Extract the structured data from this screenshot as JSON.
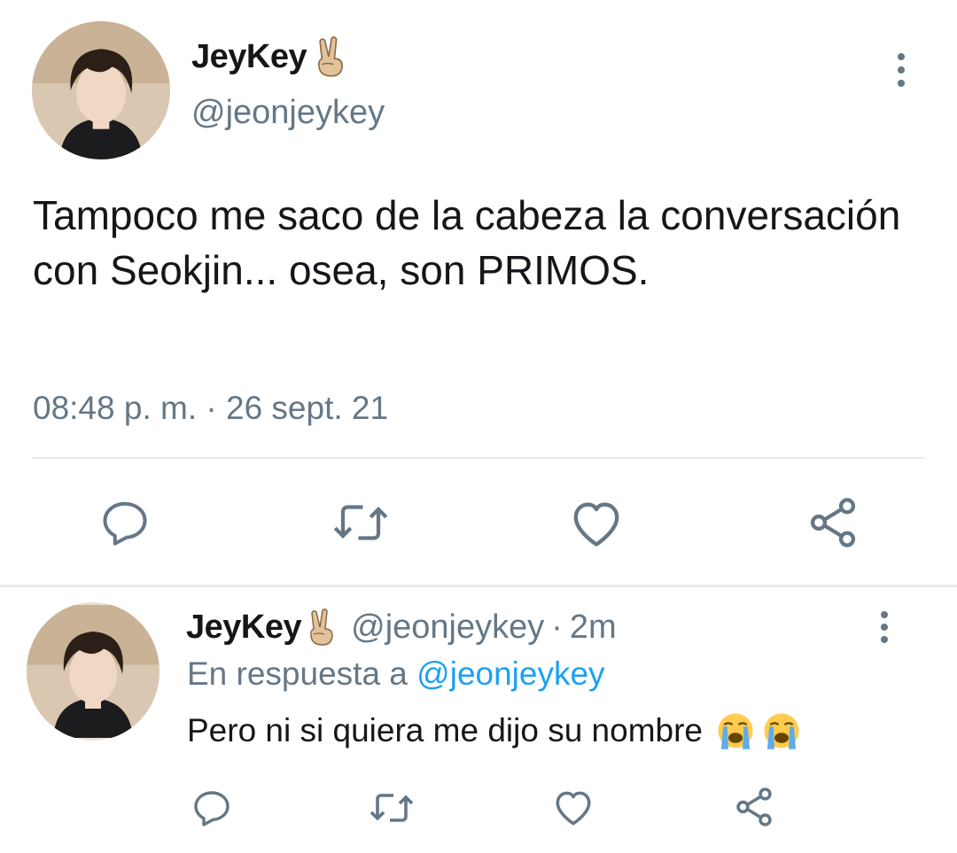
{
  "main_tweet": {
    "display_name": "JeyKey",
    "name_emoji": "victory-hand-emoji",
    "handle": "@jeonjeykey",
    "text": "Tampoco me saco de la cabeza la conversación con Seokjin... osea, son PRIMOS.",
    "timestamp": "08:48 p. m. · 26 sept. 21",
    "actions": [
      "reply-icon",
      "retweet-icon",
      "like-icon",
      "share-icon"
    ]
  },
  "reply_tweet": {
    "display_name": "JeyKey",
    "name_emoji": "victory-hand-emoji",
    "handle": "@jeonjeykey",
    "separator": "·",
    "time_ago": "2m",
    "reply_prefix": "En respuesta a",
    "reply_to_handle": "@jeonjeykey",
    "text": "Pero ni si quiera me dijo su nombre",
    "text_emojis": [
      "loudly-crying-face-emoji",
      "loudly-crying-face-emoji"
    ],
    "actions": [
      "reply-icon",
      "retweet-icon",
      "like-icon",
      "share-icon"
    ]
  },
  "colors": {
    "text": "#14171a",
    "secondary": "#657786",
    "link": "#1da1f2",
    "divider": "#e6ecf0"
  }
}
